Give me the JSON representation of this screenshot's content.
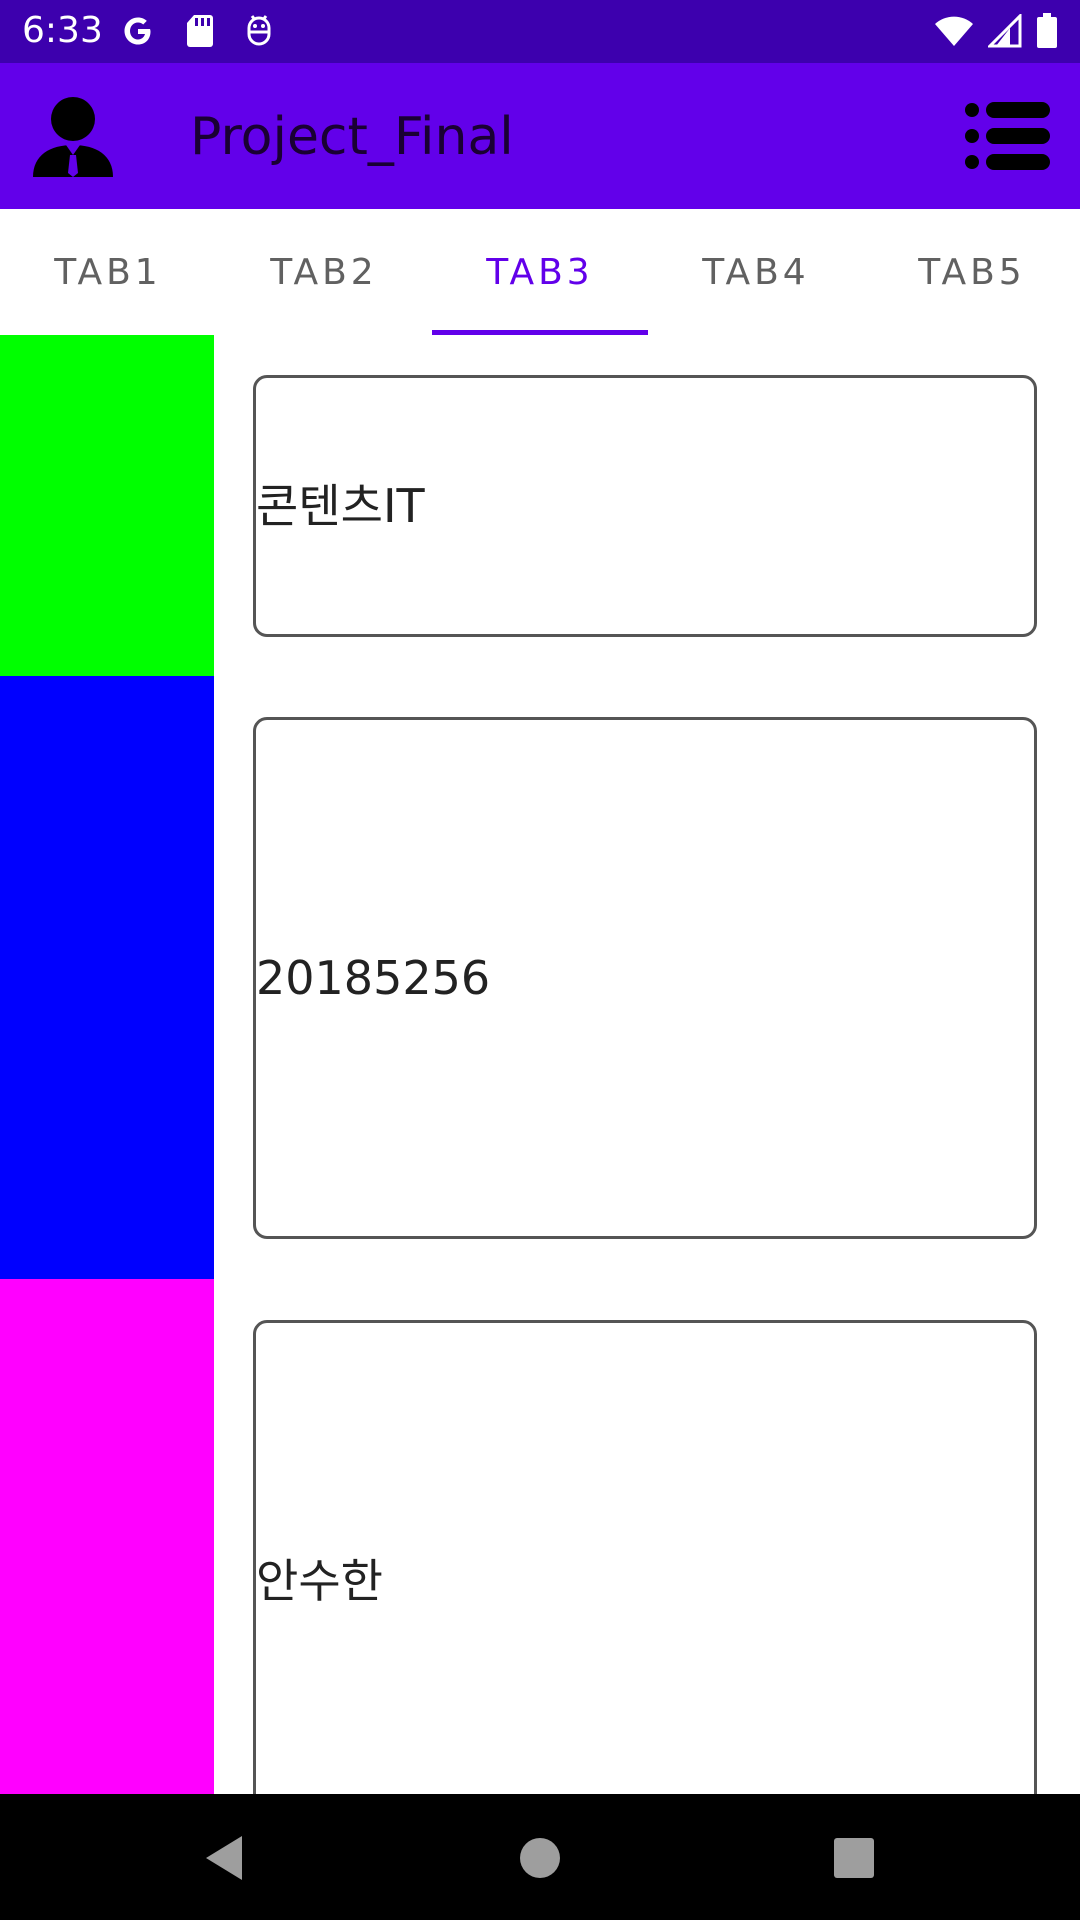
{
  "status_bar": {
    "time": "6:33",
    "left_icons": [
      "google-icon",
      "sd-card-icon",
      "android-debug-icon"
    ],
    "right_icons": [
      "wifi-icon",
      "cell-signal-icon",
      "battery-icon"
    ]
  },
  "app_bar": {
    "title": "Project_Final",
    "avatar_icon": "person-icon",
    "menu_icon": "list-menu-icon"
  },
  "tabs": [
    {
      "label": "TAB1",
      "active": false
    },
    {
      "label": "TAB2",
      "active": false
    },
    {
      "label": "TAB3",
      "active": true
    },
    {
      "label": "TAB4",
      "active": false
    },
    {
      "label": "TAB5",
      "active": false
    }
  ],
  "content": {
    "rows": [
      {
        "color": "#00ff00",
        "text": "콘텐츠IT"
      },
      {
        "color": "#0000ff",
        "text": "20185256"
      },
      {
        "color": "#ff00ff",
        "text": "안수한"
      }
    ]
  },
  "colors": {
    "status_bar": "#3d00ae",
    "app_bar": "#6200ea",
    "accent": "#6200ea"
  },
  "nav_bar": {
    "buttons": [
      "back-icon",
      "home-icon",
      "recents-icon"
    ]
  }
}
